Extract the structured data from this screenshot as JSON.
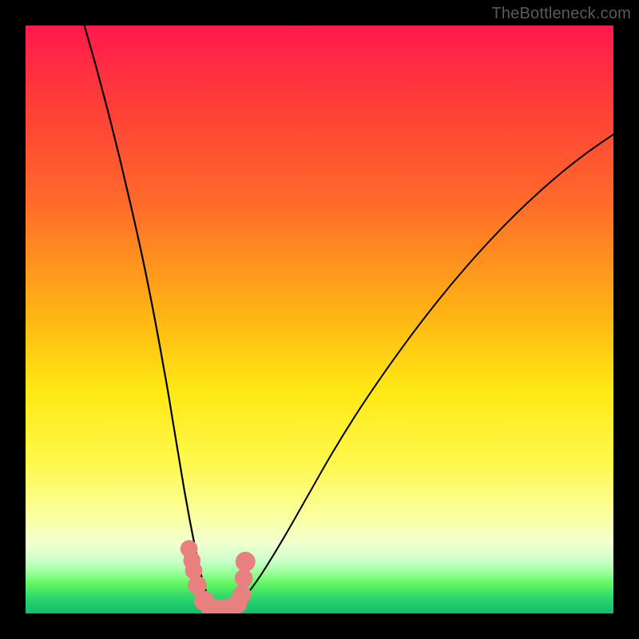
{
  "watermark": "TheBottleneck.com",
  "chart_data": {
    "type": "line",
    "title": "",
    "xlabel": "",
    "ylabel": "",
    "x_range": [
      0,
      100
    ],
    "y_range": [
      0,
      100
    ],
    "note": "Axes are not labeled in the source image; values are normalized 0–100 estimates read from pixel positions. Lower y (toward green) is the optimum; the valley bottom sits near x≈31.",
    "series": [
      {
        "name": "left-branch",
        "x": [
          10.0,
          12.0,
          14.0,
          16.0,
          18.0,
          20.0,
          22.0,
          24.0,
          25.0,
          26.0,
          27.0,
          28.0,
          29.0,
          30.0,
          31.0,
          32.0,
          33.0,
          34.0,
          35.0,
          36.0,
          37.0
        ],
        "y": [
          100.0,
          93.0,
          85.5,
          77.5,
          69.0,
          60.0,
          50.0,
          39.0,
          33.0,
          27.0,
          21.0,
          15.5,
          10.5,
          6.0,
          3.0,
          1.2,
          0.4,
          0.2,
          0.5,
          1.5,
          3.5
        ]
      },
      {
        "name": "right-branch",
        "x": [
          33.0,
          35.0,
          37.0,
          40.0,
          44.0,
          48.0,
          52.0,
          56.0,
          60.0,
          65.0,
          70.0,
          75.0,
          80.0,
          85.0,
          90.0,
          95.0,
          100.0
        ],
        "y": [
          0.4,
          0.8,
          2.5,
          6.5,
          13.0,
          20.0,
          27.0,
          33.5,
          39.5,
          46.5,
          53.0,
          59.0,
          64.5,
          69.5,
          74.0,
          78.0,
          81.5
        ]
      }
    ],
    "marker_points": {
      "comment": "Salmon-colored dots along the valley floor and lower walls.",
      "x": [
        27.8,
        28.3,
        28.6,
        29.2,
        30.3,
        31.5,
        32.8,
        34.0,
        35.0,
        36.0,
        36.8,
        37.1,
        37.4
      ],
      "y": [
        11.0,
        9.0,
        7.3,
        4.8,
        2.2,
        1.0,
        0.7,
        0.7,
        1.0,
        1.6,
        3.2,
        6.0,
        8.8
      ],
      "r": [
        1.2,
        1.2,
        1.2,
        1.4,
        1.6,
        1.6,
        1.6,
        1.6,
        1.6,
        1.5,
        1.4,
        1.3,
        1.6
      ]
    },
    "gradient_stops": [
      {
        "pos": 0.0,
        "color": "#ff1a4d"
      },
      {
        "pos": 0.3,
        "color": "#ff6a2a"
      },
      {
        "pos": 0.62,
        "color": "#ffe813"
      },
      {
        "pos": 0.88,
        "color": "#f3ffd0"
      },
      {
        "pos": 1.0,
        "color": "#14bf6a"
      }
    ]
  }
}
